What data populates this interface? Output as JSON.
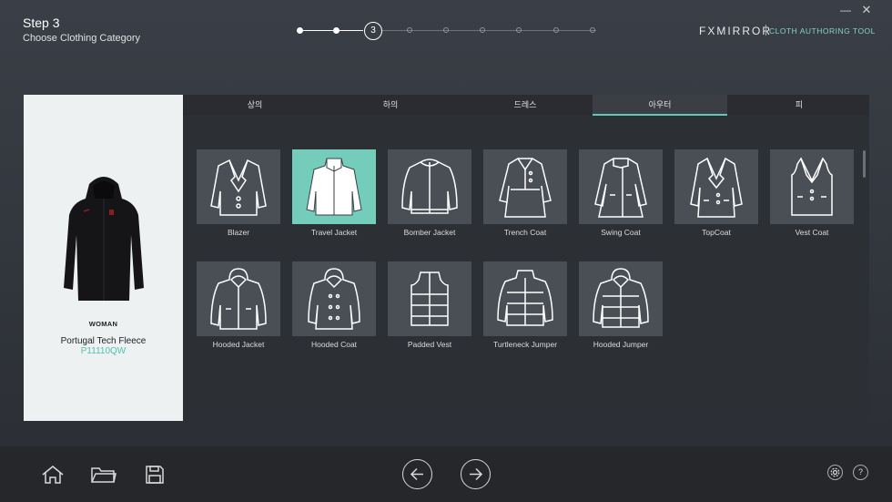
{
  "header": {
    "step_title": "Step 3",
    "step_subtitle": "Choose Clothing Category",
    "current_step": "3",
    "brand": "FXMIRROR",
    "brand_sub": "CLOTH AUTHORING TOOL",
    "minimize": "—",
    "close": "✕"
  },
  "product": {
    "gender": "WOMAN",
    "name": "Portugal Tech Fleece",
    "code": "P11110QW"
  },
  "tabs": [
    "상의",
    "하의",
    "드레스",
    "아우터",
    "피"
  ],
  "active_tab": "아우터",
  "items_row1": [
    "Blazer",
    "Travel Jacket",
    "Bomber Jacket",
    "Trench Coat",
    "Swing Coat",
    "TopCoat",
    "Vest Coat"
  ],
  "items_row2": [
    "Hooded Jacket",
    "Hooded Coat",
    "Padded Vest",
    "Turtleneck Jumper",
    "Hooded Jumper"
  ],
  "selected_item": "Travel Jacket",
  "icons": {
    "home": "home-icon",
    "folder": "folder-icon",
    "save": "save-icon",
    "back": "arrow-left-icon",
    "next": "arrow-right-icon",
    "settings": "gear-icon",
    "help": "help-icon"
  },
  "help_label": "?",
  "colors": {
    "accent": "#5fc9b6",
    "selected_tile": "#74cdbb",
    "tile": "#4a4e55"
  }
}
